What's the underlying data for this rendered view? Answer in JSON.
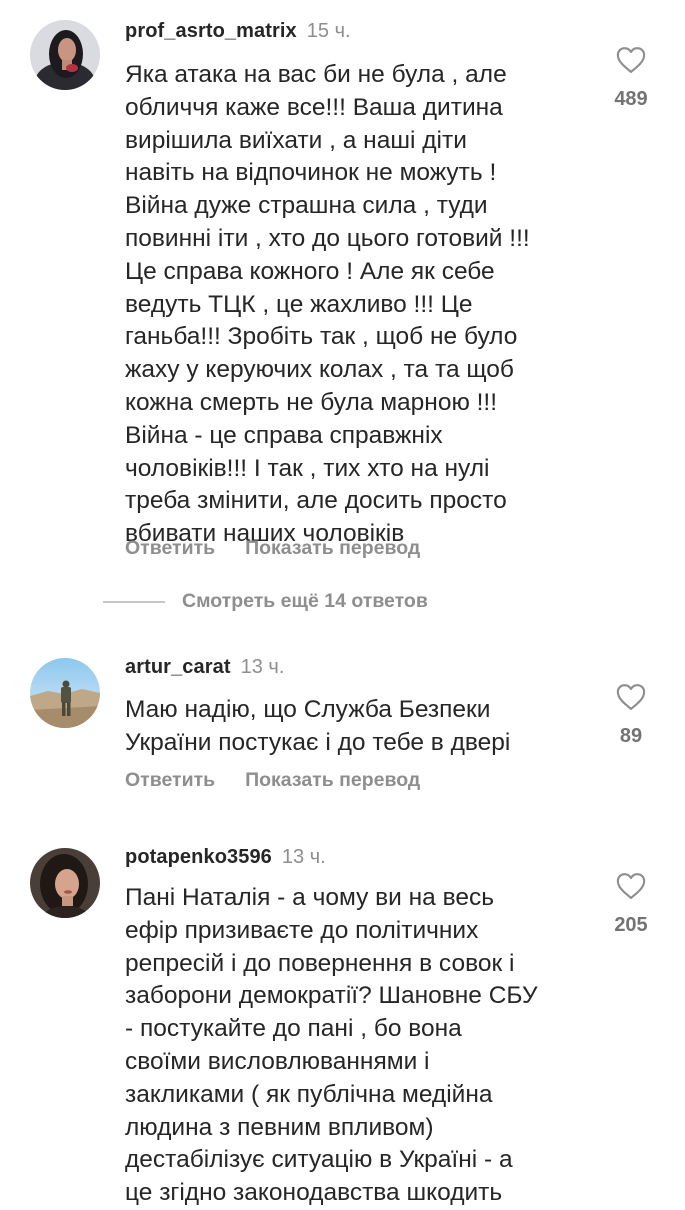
{
  "comments": [
    {
      "username": "prof_asrto_matrix",
      "time": "15 ч.",
      "lines": [
        "Яка атака на вас би не була , але",
        "обличчя каже все!!! Ваша дитина",
        "вирішила виїхати , а наші діти",
        "навіть на відпочинок не можуть !",
        "Війна дуже страшна сила , туди",
        "повинні іти , хто до цього готовий !!!",
        "Це справа кожного ! Але як себе",
        "ведуть ТЦК , це жахливо !!! Це",
        "ганьба!!! Зробіть так , щоб не було",
        "жаху у керуючих колах , та та щоб",
        "кожна смерть не була марною !!!",
        "Війна - це справа справжніх",
        "чоловіків!!! І так , тих хто на нулі",
        "треба змінити, але досить просто",
        "вбивати наших чоловіків"
      ],
      "likes": "489",
      "reply_label": "Ответить",
      "translate_label": "Показать перевод"
    },
    {
      "username": "artur_carat",
      "time": "13 ч.",
      "lines": [
        "Маю надію, що Служба Безпеки",
        "України постукає і до тебе в двері"
      ],
      "likes": "89",
      "reply_label": "Ответить",
      "translate_label": "Показать перевод"
    },
    {
      "username": "potapenko3596",
      "time": "13 ч.",
      "lines": [
        "Пані Наталія - а чому ви на весь",
        "ефір призиваєте до політичних",
        "репресій і до повернення в совок і",
        "заборони демократії? Шановне СБУ",
        "- постукайте до пані , бо вона",
        "своїми висловлюваннями і",
        "закликами ( як публічна медійна",
        "людина з певним впливом)",
        "дестабілізує ситуацію в Україні - а",
        "це згідно законодавства шкодить"
      ],
      "likes": "205"
    }
  ],
  "more_replies_label": "Смотреть ещё 14 ответов",
  "icons": {
    "like": "heart-outline-icon"
  },
  "colors": {
    "text": "#262626",
    "secondary": "#8e8e8e",
    "count": "#737373",
    "divider": "#c7c7c7"
  }
}
